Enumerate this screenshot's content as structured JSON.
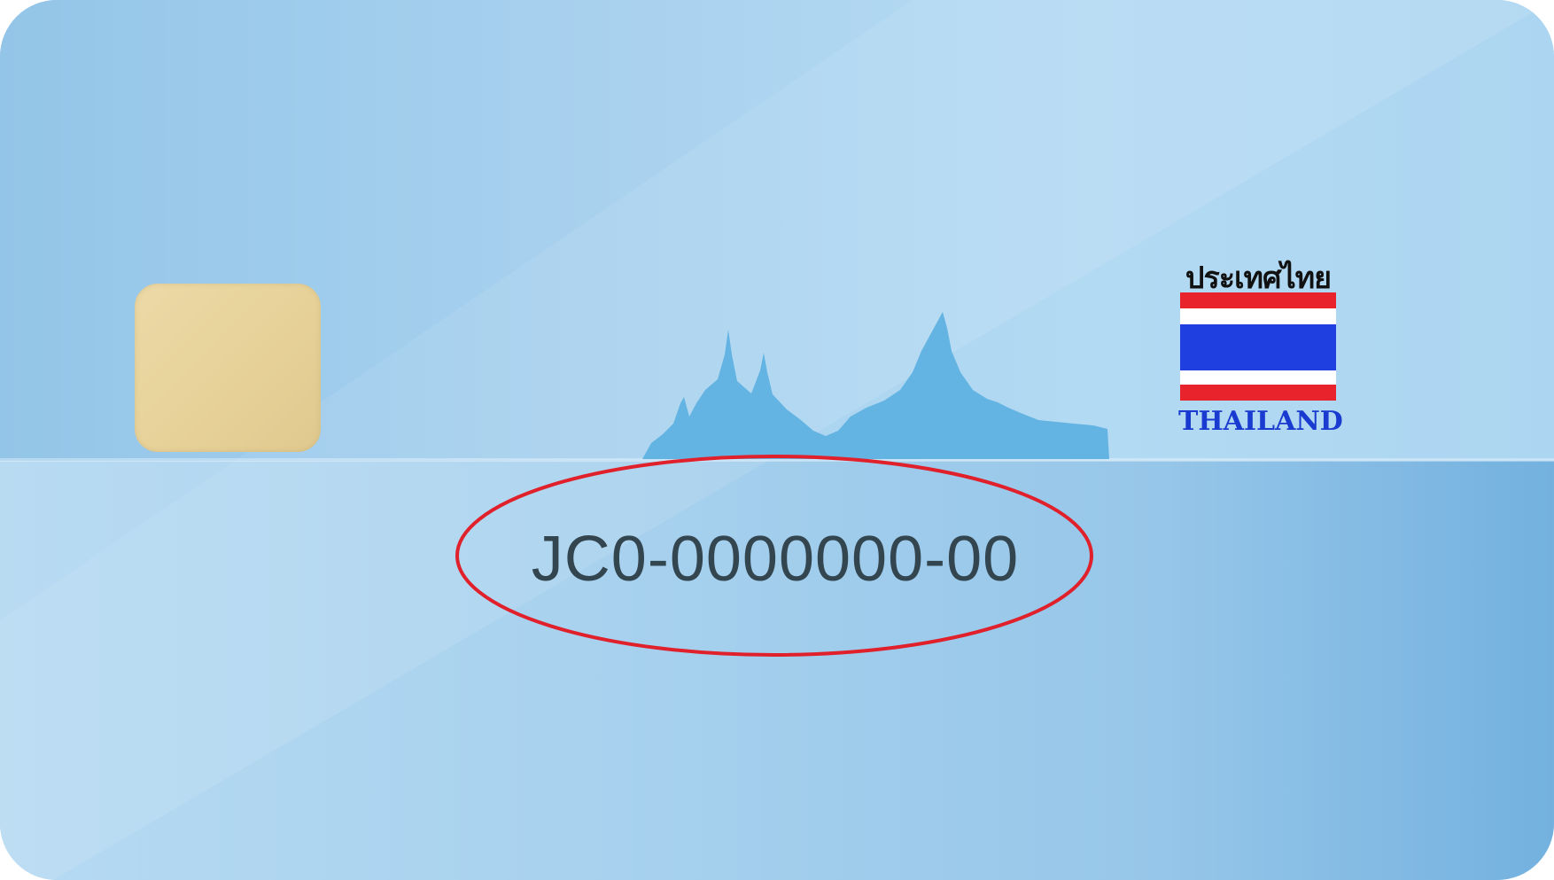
{
  "card": {
    "country_thai": "ประเทศไทย",
    "country_english": "THAILAND",
    "card_number": "JC0-0000000-00",
    "highlight_color": "#e0202a",
    "flag_colors": {
      "red": "#e8232b",
      "white": "#ffffff",
      "blue": "#1f3fe0"
    },
    "icons": [
      "chip-icon",
      "temple-skyline-icon",
      "thai-flag-icon"
    ]
  }
}
